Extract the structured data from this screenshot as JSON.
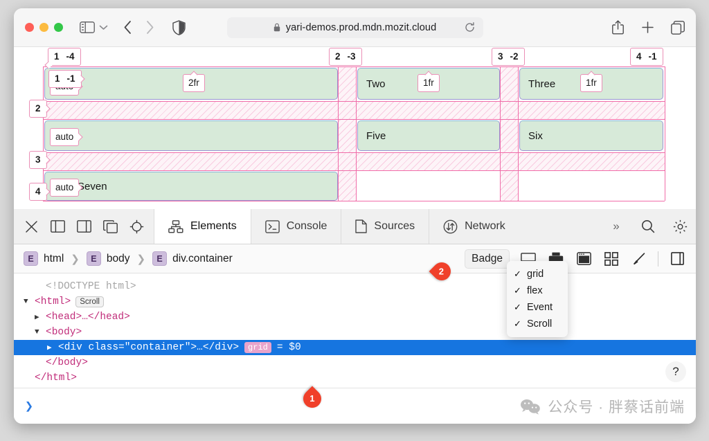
{
  "browser": {
    "url": "yari-demos.prod.mdn.mozit.cloud",
    "lock_icon": "lock-icon",
    "reload_icon": "reload-icon",
    "sidebar_icon": "sidebar-toggle-icon",
    "chevron_icon": "chevron-down-icon",
    "back_icon": "back-arrow-icon",
    "forward_icon": "forward-arrow-icon",
    "shield_icon": "privacy-shield-icon",
    "share_icon": "share-icon",
    "newtab_icon": "plus-icon",
    "tabs_icon": "tab-overview-icon"
  },
  "grid_overlay": {
    "column_labels": [
      {
        "positive": "1",
        "negative": "-4"
      },
      {
        "positive": "2",
        "negative": "-3"
      },
      {
        "positive": "3",
        "negative": "-2"
      },
      {
        "positive": "4",
        "negative": "-1"
      }
    ],
    "row_labels": [
      {
        "positive": "1",
        "negative": "-1"
      },
      {
        "positive": "2",
        "negative": ""
      },
      {
        "positive": "3",
        "negative": ""
      },
      {
        "positive": "4",
        "negative": ""
      }
    ],
    "track_sizes": {
      "row1": "auto",
      "row2": "auto",
      "row3": "auto",
      "col1": "2fr",
      "col2": "1fr",
      "col3": "1fr"
    },
    "cells": [
      {
        "text": "",
        "row": 1,
        "col": 1
      },
      {
        "text": "Two",
        "row": 1,
        "col": 2
      },
      {
        "text": "Three",
        "row": 1,
        "col": 3
      },
      {
        "text": "",
        "row": 2,
        "col": 1
      },
      {
        "text": "Five",
        "row": 2,
        "col": 2
      },
      {
        "text": "Six",
        "row": 2,
        "col": 3
      },
      {
        "text": "Seven",
        "row": 3,
        "col": 1
      }
    ]
  },
  "devtools": {
    "toolbar_icons": [
      "close-icon",
      "dock-left-icon",
      "dock-right-icon",
      "dock-window-icon",
      "inspect-picker-icon"
    ],
    "tabs": [
      {
        "label": "Elements",
        "icon": "elements-icon",
        "active": true
      },
      {
        "label": "Console",
        "icon": "console-icon",
        "active": false
      },
      {
        "label": "Sources",
        "icon": "sources-icon",
        "active": false
      },
      {
        "label": "Network",
        "icon": "network-icon",
        "active": false
      }
    ],
    "overflow_label": "»",
    "search_icon": "search-icon",
    "settings_icon": "gear-icon",
    "breadcrumb": [
      {
        "badge": "E",
        "name": "html"
      },
      {
        "badge": "E",
        "name": "body"
      },
      {
        "badge": "E",
        "name": "div.container"
      }
    ],
    "breadcrumb_separator": "❯",
    "badge_button_label": "Badge",
    "bread_icons": [
      "screenshot-icon",
      "print-icon",
      "window-icon",
      "grid-squares-icon",
      "paintbrush-icon",
      "split-panel-icon"
    ],
    "dropdown": {
      "check_glyph": "✓",
      "items": [
        {
          "label": "grid",
          "checked": true
        },
        {
          "label": "flex",
          "checked": true
        },
        {
          "label": "Event",
          "checked": true
        },
        {
          "label": "Scroll",
          "checked": true
        }
      ]
    },
    "dom_tree": {
      "doctype": "<!DOCTYPE html>",
      "lines": [
        {
          "indent": 0,
          "twisty": "",
          "text": "<!DOCTYPE html>",
          "kind": "doctype"
        },
        {
          "indent": 0,
          "twisty": "▼",
          "text": "<html>",
          "kind": "tag",
          "badge": "Scroll"
        },
        {
          "indent": 1,
          "twisty": "▶",
          "text": "<head>…</head>",
          "kind": "tag"
        },
        {
          "indent": 1,
          "twisty": "▼",
          "text": "<body>",
          "kind": "tag"
        },
        {
          "indent": 2,
          "twisty": "▶",
          "text": "<div class=\"container\">…</div>",
          "kind": "tag",
          "grid_badge": "grid",
          "suffix": "= $0",
          "selected": true
        },
        {
          "indent": 1,
          "twisty": "",
          "text": "</body>",
          "kind": "tag"
        },
        {
          "indent": 0,
          "twisty": "",
          "text": "</html>",
          "kind": "tag"
        }
      ]
    },
    "help_label": "?",
    "console_prompt": "❯"
  },
  "watermark": {
    "text": "公众号 · 胖蔡话前端",
    "icon": "wechat-icon"
  },
  "annotations": [
    {
      "number": "1"
    },
    {
      "number": "2"
    }
  ],
  "colors": {
    "grid_line": "#f06ca8",
    "cell_fill": "#d7ead9",
    "cell_border": "#9a95d4",
    "selected_row": "#1675e0",
    "pin": "#f0402a",
    "grid_badge": "#e9a4cb"
  }
}
